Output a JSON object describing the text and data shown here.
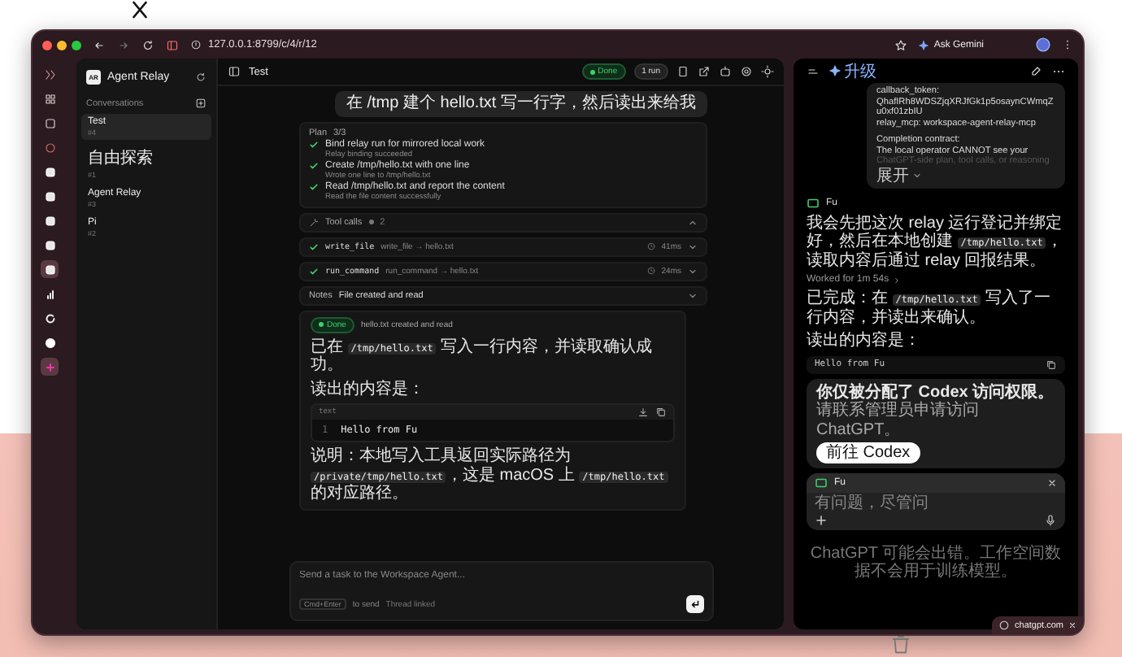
{
  "browser": {
    "url": "127.0.0.1:8799/c/4/r/12",
    "assistant_button": "Ask Gemini"
  },
  "app": {
    "name": "Agent Relay",
    "logo": "AR",
    "conversations_label": "Conversations",
    "conversations": [
      {
        "title": "Test",
        "subtitle": "#4",
        "selected": true
      },
      {
        "title": "自由探索",
        "subtitle": "#1",
        "selected": false
      },
      {
        "title": "Agent Relay",
        "subtitle": "#3",
        "selected": false
      },
      {
        "title": "Pi",
        "subtitle": "#2",
        "selected": false
      }
    ]
  },
  "thread": {
    "title": "Test",
    "status": {
      "label": "Done",
      "kind": "success"
    },
    "runs": "1 run",
    "user_message": "在 /tmp 建个 hello.txt 写一行字，然后读出来给我",
    "plan": {
      "label": "Plan",
      "count": "3/3",
      "steps": [
        {
          "title": "Bind relay run for mirrored local work",
          "detail": "Relay binding succeeded",
          "done": true
        },
        {
          "title": "Create /tmp/hello.txt with one line",
          "detail": "Wrote one line to /tmp/hello.txt",
          "done": true
        },
        {
          "title": "Read /tmp/hello.txt and report the content",
          "detail": "Read the file content successfully",
          "done": true
        }
      ]
    },
    "tool_calls": {
      "label": "Tool calls",
      "count": "2",
      "expanded": true,
      "calls": [
        {
          "name": "write_file",
          "summary": "write_file → hello.txt",
          "duration": "41ms",
          "done": true
        },
        {
          "name": "run_command",
          "summary": "run_command → hello.txt",
          "duration": "24ms",
          "done": true
        }
      ]
    },
    "notes": {
      "label": "Notes",
      "summary": "File created and read",
      "expanded": false
    },
    "result": {
      "status": {
        "label": "Done",
        "kind": "success"
      },
      "title": "hello.txt created and read",
      "paragraphs": [
        [
          {
            "kind": "text",
            "text": "已在 "
          },
          {
            "kind": "code",
            "text": "/tmp/hello.txt"
          },
          {
            "kind": "text",
            "text": " 写入一行内容，并读取确认成功。"
          }
        ],
        [
          {
            "kind": "text",
            "text": "读出的内容是："
          }
        ]
      ],
      "code": {
        "language": "text",
        "lines": [
          {
            "number": "1",
            "text": "Hello from Fu"
          }
        ]
      },
      "note": [
        {
          "kind": "text",
          "text": "说明：本地写入工具返回实际路径为 "
        },
        {
          "kind": "code",
          "text": "/private/tmp/hello.txt"
        },
        {
          "kind": "text",
          "text": "，这是 macOS 上 "
        },
        {
          "kind": "code",
          "text": "/tmp/hello.txt"
        },
        {
          "kind": "text",
          "text": " 的对应路径。"
        }
      ]
    },
    "composer": {
      "placeholder": "Send a task to the Workspace Agent...",
      "shortcut": "Cmd+Enter",
      "shortcut_hint": "to send",
      "link_status": "Thread linked"
    }
  },
  "chat": {
    "upgrade": "升级",
    "bubble": {
      "lines": [
        {
          "text": "callback_token:",
          "faded": false
        },
        {
          "text": "QhafIRh8WDSZjqXRJfGk1p5osaynCWmqZu0xf01zbIU",
          "faded": false
        },
        {
          "text": "relay_mcp: workspace-agent-relay-mcp",
          "faded": false
        },
        {
          "text": "Completion contract:",
          "faded": false
        },
        {
          "text": "The local operator CANNOT see your",
          "faded": false
        },
        {
          "text": "ChatGPT-side plan, tool calls, or reasoning",
          "faded": true
        }
      ],
      "expand": "展开"
    },
    "assistant": "Fu",
    "messages": [
      {
        "kind": "text",
        "segments": [
          {
            "kind": "text",
            "text": "我会先把这次 relay 运行登记并绑定好，然后在本地创建 "
          },
          {
            "kind": "code",
            "text": "/tmp/hello.txt"
          },
          {
            "kind": "text",
            "text": "，读取内容后通过 relay 回报结果。"
          }
        ]
      },
      {
        "kind": "worked",
        "text": "Worked for 1m 54s"
      },
      {
        "kind": "text",
        "segments": [
          {
            "kind": "text",
            "text": "已完成：在 "
          },
          {
            "kind": "code",
            "text": "/tmp/hello.txt"
          },
          {
            "kind": "text",
            "text": " 写入了一行内容，并读出来确认。"
          }
        ]
      },
      {
        "kind": "text",
        "segments": [
          {
            "kind": "text",
            "text": "读出的内容是："
          }
        ]
      },
      {
        "kind": "code",
        "text": "Hello from Fu"
      }
    ],
    "notice": {
      "title": "你仅被分配了 Codex 访问权限。",
      "body": "请联系管理员申请访问 ChatGPT。",
      "button": "前往 Codex"
    },
    "composer": {
      "project": "Fu",
      "placeholder": "有问题，尽管问"
    },
    "footer": "ChatGPT 可能会出错。工作空间数据不会用于训练模型。",
    "tab": "chatgpt.com"
  }
}
